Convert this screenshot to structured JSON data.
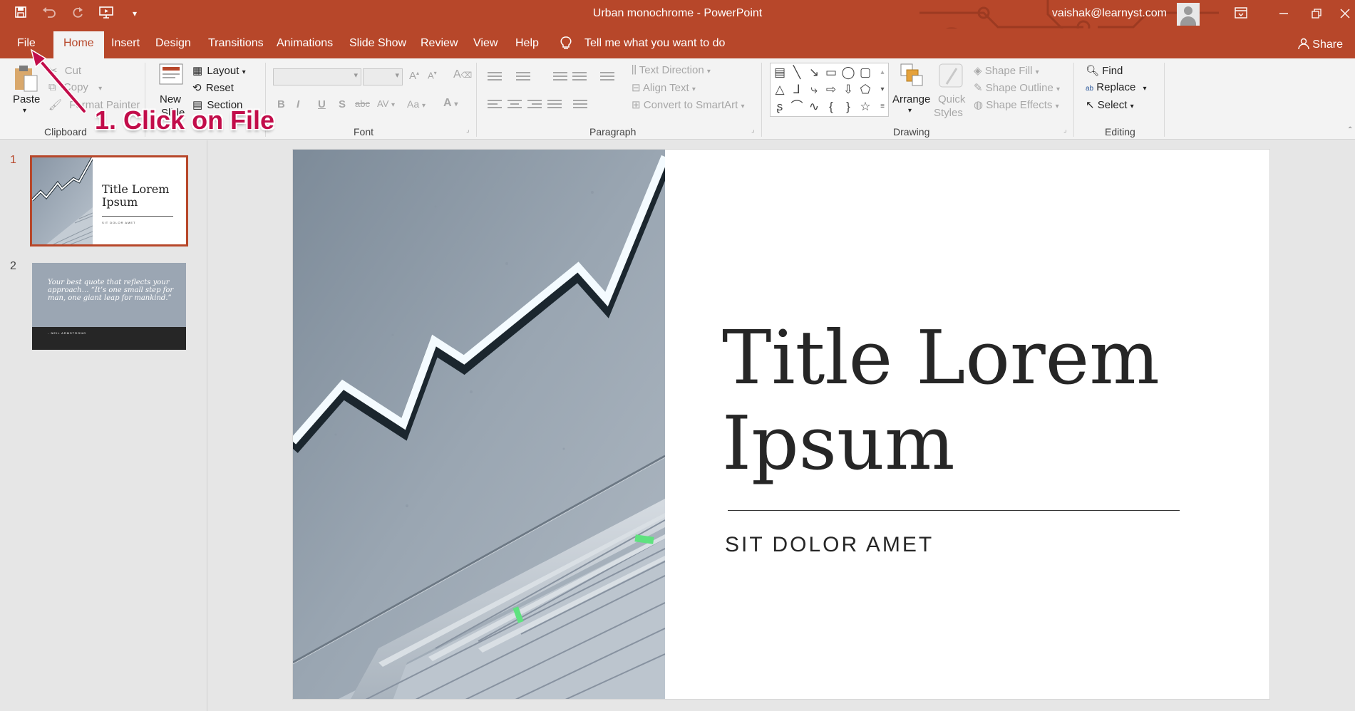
{
  "titlebar": {
    "doc_title": "Urban monochrome  -  PowerPoint",
    "user": "vaishak@learnyst.com",
    "qat": [
      "save-icon",
      "undo-icon",
      "redo-icon",
      "present-from-beginning-icon",
      "customize-qat-icon"
    ],
    "controls": [
      "ribbon-display-options-icon",
      "minimize-icon",
      "restore-icon",
      "close-icon"
    ]
  },
  "tabs": {
    "items": [
      "File",
      "Home",
      "Insert",
      "Design",
      "Transitions",
      "Animations",
      "Slide Show",
      "Review",
      "View",
      "Help"
    ],
    "active": "Home",
    "tell_me": "Tell me what you want to do",
    "share": "Share"
  },
  "ribbon": {
    "clipboard": {
      "label": "Clipboard",
      "paste": "Paste",
      "cut": "Cut",
      "copy": "Copy",
      "format_painter": "Format Painter"
    },
    "slides": {
      "new_slide_1": "New",
      "new_slide_2": "Slide",
      "layout": "Layout",
      "reset": "Reset",
      "section": "Section"
    },
    "font": {
      "label": "Font",
      "font_name": "",
      "font_size": "",
      "bold": "B",
      "italic": "I",
      "underline": "U",
      "shadow": "S",
      "strike": "abc",
      "spacing": "AV",
      "case": "Aa",
      "color": "A"
    },
    "paragraph": {
      "label": "Paragraph",
      "text_direction": "Text Direction",
      "align_text": "Align Text",
      "smartart": "Convert to SmartArt"
    },
    "drawing": {
      "label": "Drawing",
      "arrange": "Arrange",
      "quick_styles_1": "Quick",
      "quick_styles_2": "Styles",
      "shape_fill": "Shape Fill",
      "shape_outline": "Shape Outline",
      "shape_effects": "Shape Effects"
    },
    "editing": {
      "label": "Editing",
      "find": "Find",
      "replace": "Replace",
      "select": "Select"
    }
  },
  "thumbnails": {
    "slides": [
      {
        "number": "1",
        "title": "Title Lorem Ipsum",
        "subtitle": "SIT DOLOR AMET"
      },
      {
        "number": "2",
        "quote": "Your best quote that reflects your approach… “It’s one small step for man, one giant leap for mankind.”",
        "author": "- NEIL ARMSTRONG"
      }
    ]
  },
  "slide": {
    "title_line1": "Title Lorem",
    "title_line2": "Ipsum",
    "subtitle": "SIT DOLOR AMET"
  },
  "annotation": {
    "text": "1. Click on File",
    "color": "#c20d4a"
  },
  "colors": {
    "accent": "#b7472a",
    "ribbon_bg": "#f3f3f3",
    "panel_bg": "#e6e6e6"
  }
}
